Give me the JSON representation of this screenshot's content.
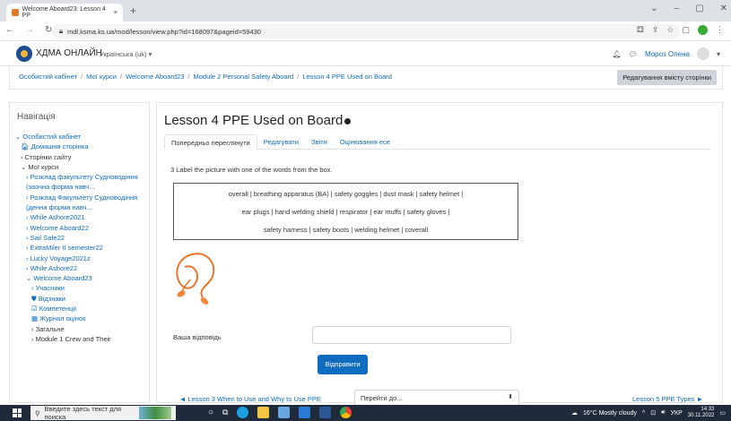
{
  "browser": {
    "tab_title": "Welcome Aboard23: Lesson 4 PP",
    "tab_close": "×",
    "new_tab": "+",
    "url": "mdl.ksma.ks.ua/mod/lesson/view.php?id=168097&pageid=59430",
    "window_controls": [
      "⌄",
      "–",
      "▢",
      "✕"
    ]
  },
  "site": {
    "name": "ХДМА ОНЛАЙН",
    "language": "Українська (uk) ▾",
    "user_name": "Мороз Олена"
  },
  "breadcrumb": [
    "Особистий кабінет",
    "Мої курси",
    "Welcome Aboard23",
    "Module 2 Personal Safety Aboard",
    "Lesson 4 PPE Used on Board"
  ],
  "edit_page_button": "Редагування вмісту сторінки",
  "nav": {
    "title": "Навігація",
    "items": [
      {
        "label": "⌄ Особистий кабінет",
        "indent": 0,
        "color": "#0f6cbf"
      },
      {
        "label": "🏠︎ Домашня сторінка",
        "indent": 1,
        "color": "#0f6cbf"
      },
      {
        "label": "› Сторінки сайту",
        "indent": 1,
        "color": "#333"
      },
      {
        "label": "⌄ Мої курси",
        "indent": 1,
        "color": "#333"
      },
      {
        "label": "› Розклад факультету Судноводіння (заочна форма навч...",
        "indent": 2,
        "color": "#0f6cbf"
      },
      {
        "label": "› Розклад Факультету Судноводіння (денна форма навч...",
        "indent": 2,
        "color": "#0f6cbf"
      },
      {
        "label": "› While Ashore2021",
        "indent": 2,
        "color": "#0f6cbf"
      },
      {
        "label": "› Welcome Aboard22",
        "indent": 2,
        "color": "#0f6cbf"
      },
      {
        "label": "› Sail Safe22",
        "indent": 2,
        "color": "#0f6cbf"
      },
      {
        "label": "› ExtraMiler II semester22",
        "indent": 2,
        "color": "#0f6cbf"
      },
      {
        "label": "› Lucky Voyage2021z",
        "indent": 2,
        "color": "#0f6cbf"
      },
      {
        "label": "› While Ashore22",
        "indent": 2,
        "color": "#0f6cbf"
      },
      {
        "label": "⌄ Welcome Aboard23",
        "indent": 2,
        "color": "#0f6cbf"
      },
      {
        "label": "› Учасники",
        "indent": 3,
        "color": "#0f6cbf"
      },
      {
        "label": "⛊ Відзнаки",
        "indent": 3,
        "color": "#0f6cbf"
      },
      {
        "label": "☑ Компетенції",
        "indent": 3,
        "color": "#0f6cbf"
      },
      {
        "label": "▦ Журнал оцінок",
        "indent": 3,
        "color": "#0f6cbf"
      },
      {
        "label": "› Загальне",
        "indent": 3,
        "color": "#333"
      },
      {
        "label": "› Module 1 Crew and Their",
        "indent": 3,
        "color": "#333"
      }
    ]
  },
  "lesson": {
    "title": "Lesson 4 PPE Used on Board",
    "tabs": [
      "Попередньо переглянути",
      "Редагувати",
      "Звіти",
      "Оцінювання есе"
    ],
    "question": "3 Label the picture with one of the words from the box.",
    "word_lines": [
      "overall | breathing apparatus (BA) | safety goggles | dust mask | safety helmet |",
      "ear plugs | hand welding shield | respirator | ear muffs | safety gloves |",
      "safety harness | safety boots | welding helmet | coverall"
    ],
    "answer_label": "Ваша відповідь",
    "answer_value": "",
    "submit_label": "Відправити",
    "prev_link": "◄ Lesson 3 When to Use and Why to Use PPE",
    "jump_select": "Перейти до...",
    "next_link": "Lesson 5 PPE Types ►"
  },
  "taskbar": {
    "search_placeholder": "Введите здесь текст для поиска",
    "weather": "16°C Mostly cloudy",
    "lang": "УКР",
    "time": "14:33",
    "date": "30.11.2022"
  },
  "colors": {
    "accent": "#0f6cbf",
    "taskbar": "#1f2a3a"
  }
}
